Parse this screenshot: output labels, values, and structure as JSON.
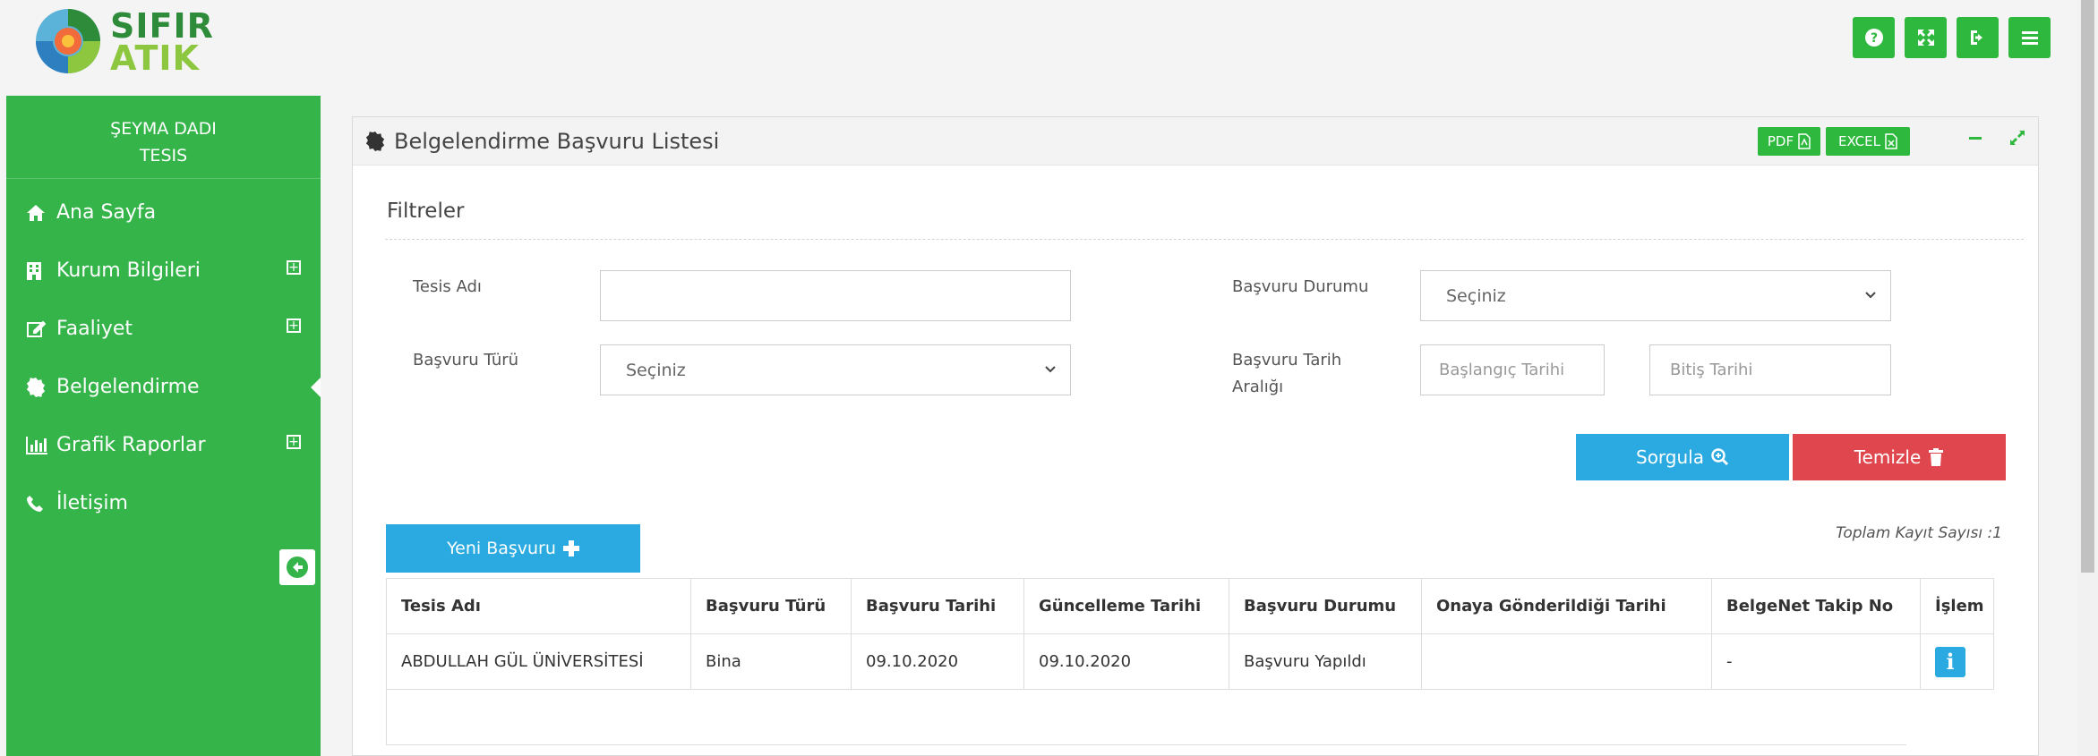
{
  "logo": {
    "line1": "SIFIR",
    "line2": "ATIK"
  },
  "top_buttons": [
    {
      "name": "help-icon",
      "glyph": "?"
    },
    {
      "name": "fullscreen-icon",
      "glyph": "⤢"
    },
    {
      "name": "logout-icon",
      "glyph": "➜"
    },
    {
      "name": "menu-icon",
      "glyph": "≡"
    }
  ],
  "sidebar": {
    "user_name": "ŞEYMA DADI",
    "user_role": "TESIS",
    "items": [
      {
        "label": "Ana Sayfa",
        "icon": "home-icon",
        "expandable": false
      },
      {
        "label": "Kurum Bilgileri",
        "icon": "building-icon",
        "expandable": true
      },
      {
        "label": "Faaliyet",
        "icon": "edit-icon",
        "expandable": true
      },
      {
        "label": "Belgelendirme",
        "icon": "certificate-icon",
        "expandable": false,
        "active": true
      },
      {
        "label": "Grafik Raporlar",
        "icon": "bar-chart-icon",
        "expandable": true
      },
      {
        "label": "İletişim",
        "icon": "phone-icon",
        "expandable": false
      }
    ]
  },
  "panel": {
    "title": "Belgelendirme Başvuru Listesi",
    "pdf_label": "PDF",
    "excel_label": "EXCEL"
  },
  "filters": {
    "title": "Filtreler",
    "tesis_adi_label": "Tesis Adı",
    "tesis_adi_value": "",
    "basvuru_durumu_label": "Başvuru Durumu",
    "basvuru_durumu_value": "Seçiniz",
    "basvuru_turu_label": "Başvuru Türü",
    "basvuru_turu_value": "Seçiniz",
    "tarih_araligi_label_1": "Başvuru Tarih",
    "tarih_araligi_label_2": "Aralığı",
    "baslangic_placeholder": "Başlangıç Tarihi",
    "bitis_placeholder": "Bitiş Tarihi",
    "sorgula_label": "Sorgula",
    "temizle_label": "Temizle"
  },
  "new_button_label": "Yeni Başvuru",
  "total_label": "Toplam Kayıt Sayısı :1",
  "table": {
    "headers": [
      "Tesis Adı",
      "Başvuru Türü",
      "Başvuru Tarihi",
      "Güncelleme Tarihi",
      "Başvuru Durumu",
      "Onaya Gönderildiği Tarihi",
      "BelgeNet Takip No",
      "İşlem"
    ],
    "rows": [
      [
        "ABDULLAH GÜL ÜNİVERSİTESİ",
        "Bina",
        "09.10.2020",
        "09.10.2020",
        "Başvuru Yapıldı",
        "",
        "-",
        "i"
      ]
    ]
  },
  "colors": {
    "green": "#35b44a",
    "button_green": "#2fb83e",
    "blue": "#2aaae1",
    "red": "#e0464e"
  }
}
